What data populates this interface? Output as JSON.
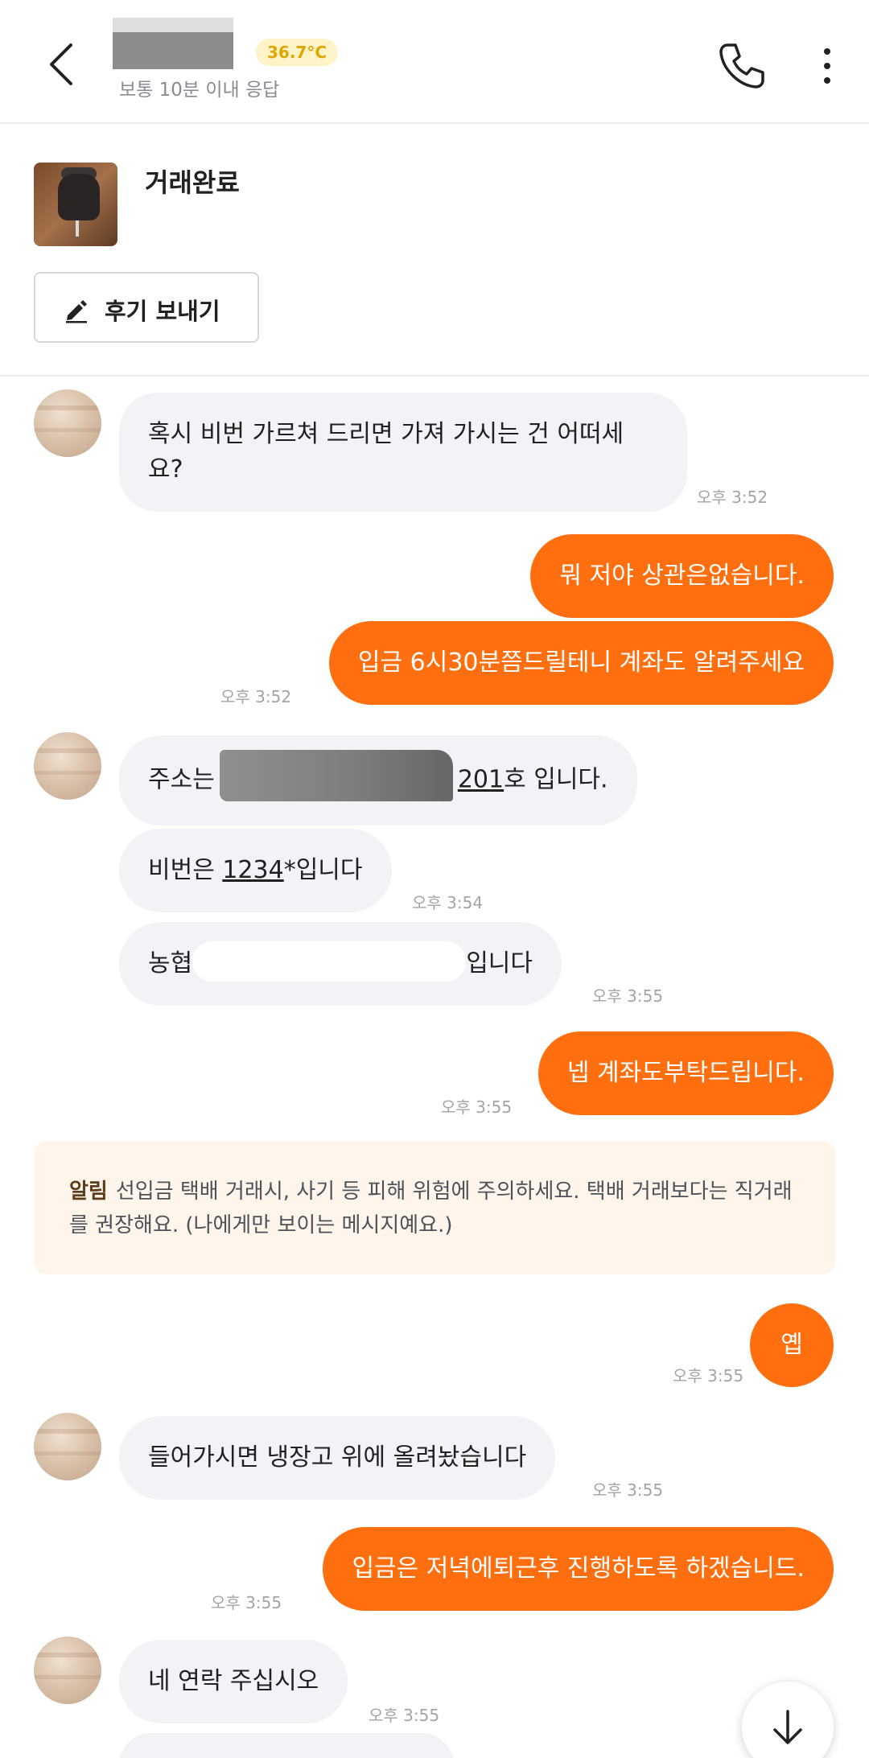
{
  "header": {
    "manner_temp": "36.7°C",
    "response_time": "보통 10분 이내 응답"
  },
  "trade": {
    "status": "거래완료",
    "review_button": "후기 보내기"
  },
  "messages": [
    {
      "side": "in",
      "text": "혹시 비번 가르쳐 드리면 가져 가시는 건 어떠세요?",
      "time": "오후 3:52"
    },
    {
      "side": "out",
      "text": "뭐 저야 상관은없습니다.",
      "time": ""
    },
    {
      "side": "out",
      "text": "입금 6시30분쯤드릴테니 계좌도 알려주세요",
      "time": "오후 3:52"
    },
    {
      "side": "in",
      "text_before": "주소는",
      "text_num": "201",
      "text_after": "호 입니다.",
      "time": ""
    },
    {
      "side": "in",
      "text_before": "비번은 ",
      "text_num": "1234",
      "text_after": "*입니다",
      "time": "오후 3:54"
    },
    {
      "side": "in",
      "text_before": "농협",
      "text_after": "입니다",
      "time": "오후 3:55"
    },
    {
      "side": "out",
      "text": "넵 계좌도부탁드립니다.",
      "time": "오후 3:55"
    },
    {
      "side": "out",
      "text": "옙",
      "time": "오후 3:55"
    },
    {
      "side": "in",
      "text": "들어가시면 냉장고 위에 올려놨습니다",
      "time": "오후 3:55"
    },
    {
      "side": "out",
      "text": "입금은 저녁에퇴근후 진행하도록 하겠습니드.",
      "time": "오후 3:55"
    },
    {
      "side": "in",
      "text": "네 연락 주십시오",
      "time": "오후 3:55"
    }
  ],
  "notice": {
    "label": "알림",
    "text": "선입금 택배 거래시, 사기 등 피해 위험에 주의하세요. 택배 거래보다는 직거래를 권장해요. (나에게만 보이는 메시지예요.)"
  },
  "colors": {
    "accent": "#ff6f0f",
    "incoming_bubble": "#f2f3f6",
    "notice_bg": "#fff5eb"
  }
}
